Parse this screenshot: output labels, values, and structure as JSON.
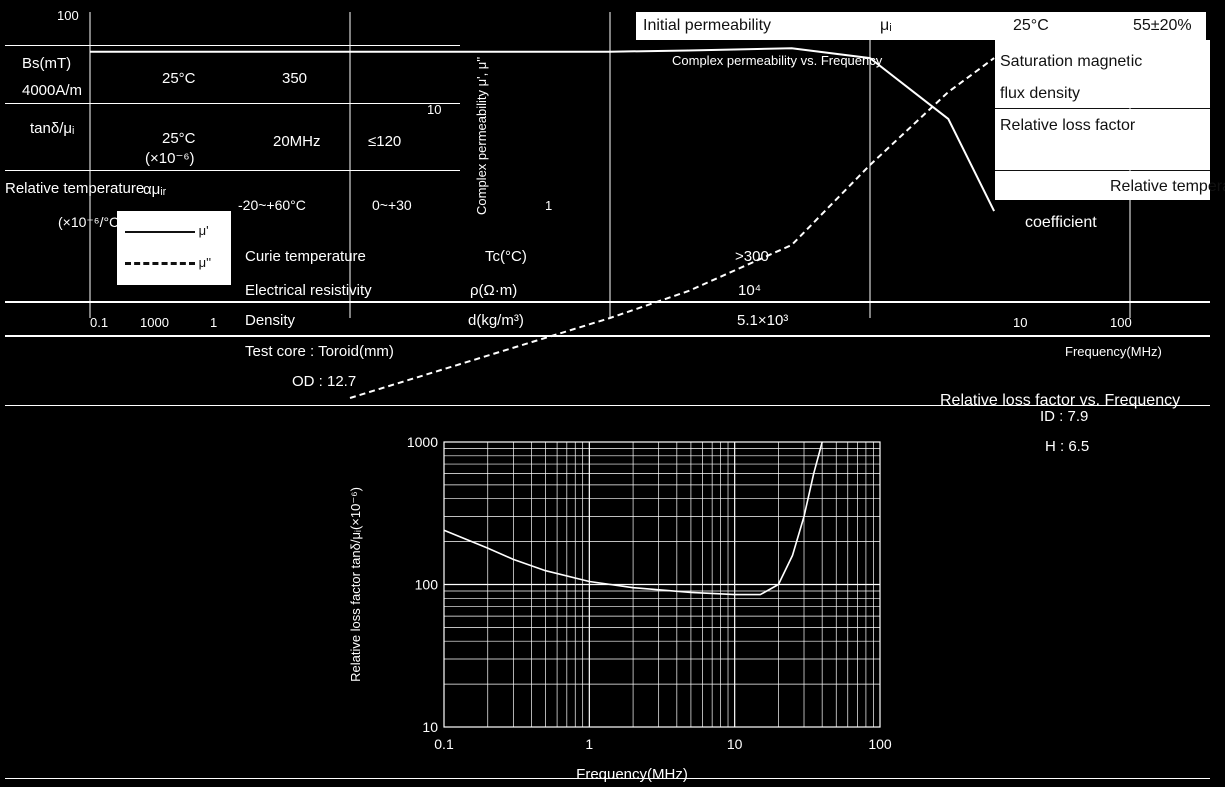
{
  "spec_table": {
    "initial_permeability": {
      "label": "Initial permeability",
      "symbol": "μᵢ",
      "condition": "25°C",
      "value": "55±20%"
    },
    "saturation": {
      "label": "Saturation magnetic",
      "label2": "flux density",
      "symbol": "Bs(mT)",
      "field": "4000A/m",
      "condition": "25°C",
      "value": "350"
    },
    "loss_factor": {
      "label": "Relative loss factor",
      "symbol": "tanδ/μᵢ",
      "unit": "(×10⁻⁶)",
      "condition": "25°C",
      "freq": "20MHz",
      "value": "≤120"
    },
    "temp_coeff": {
      "label": "Relative temperature",
      "label2": "coefficient",
      "symbol": "αμᵢᵣ",
      "unit": "(×10⁻⁶/°C)",
      "condition": "-20~+60°C",
      "value": "0~+30"
    },
    "curie": {
      "label": "Curie temperature",
      "symbol": "Tc(°C)",
      "value": ">300"
    },
    "resistivity": {
      "label": "Electrical resistivity",
      "symbol": "ρ(Ω·m)",
      "value": "10⁴"
    },
    "density": {
      "label": "Density",
      "symbol": "d(kg/m³)",
      "value": "5.1×10³"
    },
    "test_core": {
      "label": "Test core : Toroid(mm)",
      "od": "OD : 12.7",
      "id": "ID : 7.9",
      "h": "H : 6.5"
    }
  },
  "top_chart": {
    "title": "Complex permeability vs. Frequency",
    "ylabel": "Complex permeability μ', μ''",
    "xlabel": "Frequency(MHz)",
    "y_ticks": [
      "100",
      "10",
      "1"
    ],
    "x_ticks": [
      "0.1",
      "1",
      "10",
      "100",
      "1000"
    ],
    "legend": {
      "mu_prime": "μ'",
      "mu_dprime": "μ''"
    }
  },
  "chart_data": [
    {
      "type": "line",
      "title": "Complex permeability vs. Frequency",
      "xlabel": "Frequency(MHz)",
      "ylabel": "Complex permeability μ', μ''",
      "x_scale": "log",
      "y_scale": "log",
      "xlim": [
        0.1,
        1000
      ],
      "ylim": [
        1,
        100
      ],
      "series": [
        {
          "name": "μ'",
          "x": [
            0.1,
            1,
            10,
            20,
            50,
            100,
            200,
            300
          ],
          "y": [
            55,
            55,
            55,
            56,
            58,
            50,
            20,
            5
          ]
        },
        {
          "name": "μ''",
          "x": [
            1,
            10,
            20,
            50,
            100,
            200,
            300
          ],
          "y": [
            0.3,
            1,
            1.5,
            3,
            10,
            30,
            50
          ]
        }
      ],
      "legend_position": "bottom-left"
    },
    {
      "type": "line",
      "title": "Relative loss factor vs. Frequency",
      "xlabel": "Frequency(MHz)",
      "ylabel": "Relative loss factor tanδ/μᵢ(×10⁻⁶)",
      "x_scale": "log",
      "y_scale": "log",
      "xlim": [
        0.1,
        100
      ],
      "ylim": [
        10,
        1000
      ],
      "x_ticks": [
        "0.1",
        "1",
        "10",
        "100"
      ],
      "y_ticks": [
        "1000",
        "100",
        "10"
      ],
      "grid": true,
      "series": [
        {
          "x": [
            0.1,
            0.2,
            0.3,
            0.5,
            1,
            2,
            5,
            10,
            15,
            20,
            25,
            30,
            35,
            40
          ],
          "y": [
            240,
            180,
            150,
            125,
            105,
            95,
            88,
            85,
            85,
            100,
            160,
            300,
            600,
            1000
          ]
        }
      ]
    }
  ]
}
